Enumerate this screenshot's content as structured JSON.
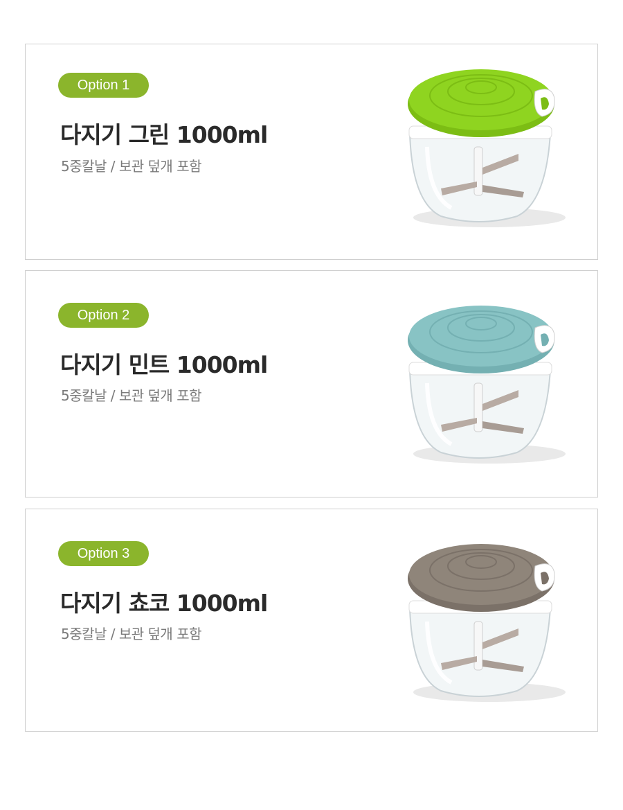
{
  "options": [
    {
      "badge": "Option 1",
      "title": "다지기 그린 1000ml",
      "subtitle": "5중칼날 / 보관 덮개 포함",
      "lid_color": "#8fd420",
      "lid_ring": "#7cbd14",
      "badge_color": "#8bb52c",
      "icon": "green-chopper-icon"
    },
    {
      "badge": "Option 2",
      "title": "다지기 민트 1000ml",
      "subtitle": "5중칼날 / 보관 덮개 포함",
      "lid_color": "#88c3c4",
      "lid_ring": "#74b0b2",
      "badge_color": "#8bb52c",
      "icon": "mint-chopper-icon"
    },
    {
      "badge": "Option 3",
      "title": "다지기 쵸코 1000ml",
      "subtitle": "5중칼날 / 보관 덮개 포함",
      "lid_color": "#8f857a",
      "lid_ring": "#7b7168",
      "badge_color": "#8bb52c",
      "icon": "choco-chopper-icon"
    }
  ]
}
